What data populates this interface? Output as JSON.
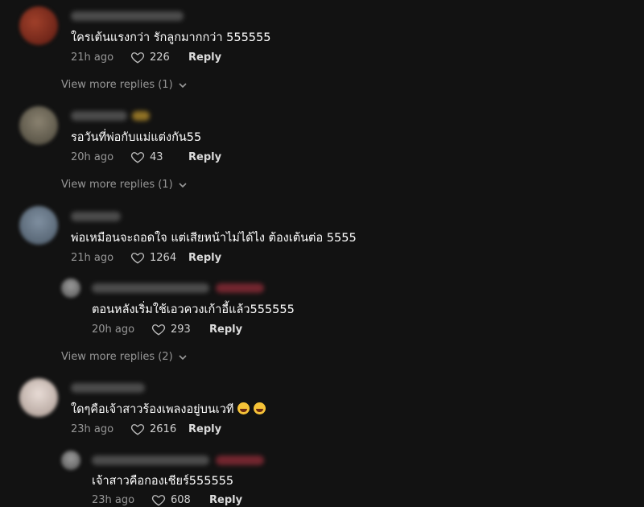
{
  "ui": {
    "reply_label": "Reply"
  },
  "comments": [
    {
      "text": "ใครเต้นแรงกว่า รักลูกมากกว่า 555555",
      "time": "21h ago",
      "likes": "226",
      "view_more": "View more replies (1)"
    },
    {
      "text": "รอวันที่พ่อกับแม่แต่งกัน55",
      "time": "20h ago",
      "likes": "43",
      "view_more": "View more replies (1)"
    },
    {
      "text": "พ่อเหมือนจะถอดใจ แต่เสียหน้าไม่ได้ไง ต้องเต้นต่อ 5555",
      "time": "21h ago",
      "likes": "1264",
      "reply": {
        "text": "ตอนหลังเริ่มใช้เอวควงเก้าอี้แล้ว555555",
        "time": "20h ago",
        "likes": "293"
      },
      "view_more": "View more replies (2)"
    },
    {
      "text": "ใดๆคือเจ้าสาวร้องเพลงอยู่บนเวที",
      "time": "23h ago",
      "likes": "2616",
      "emojis": [
        "face-with-tears-of-joy",
        "face-with-tears-of-joy"
      ],
      "reply": {
        "text": "เจ้าสาวคือกองเชียร์555555",
        "time": "23h ago",
        "likes": "608"
      }
    }
  ],
  "icons": {
    "like": "heart-outline-icon",
    "expand": "chevron-down-icon"
  },
  "colors": {
    "background": "#121212",
    "text": "#ffffff",
    "muted": "rgba(255,255,255,0.55)"
  }
}
